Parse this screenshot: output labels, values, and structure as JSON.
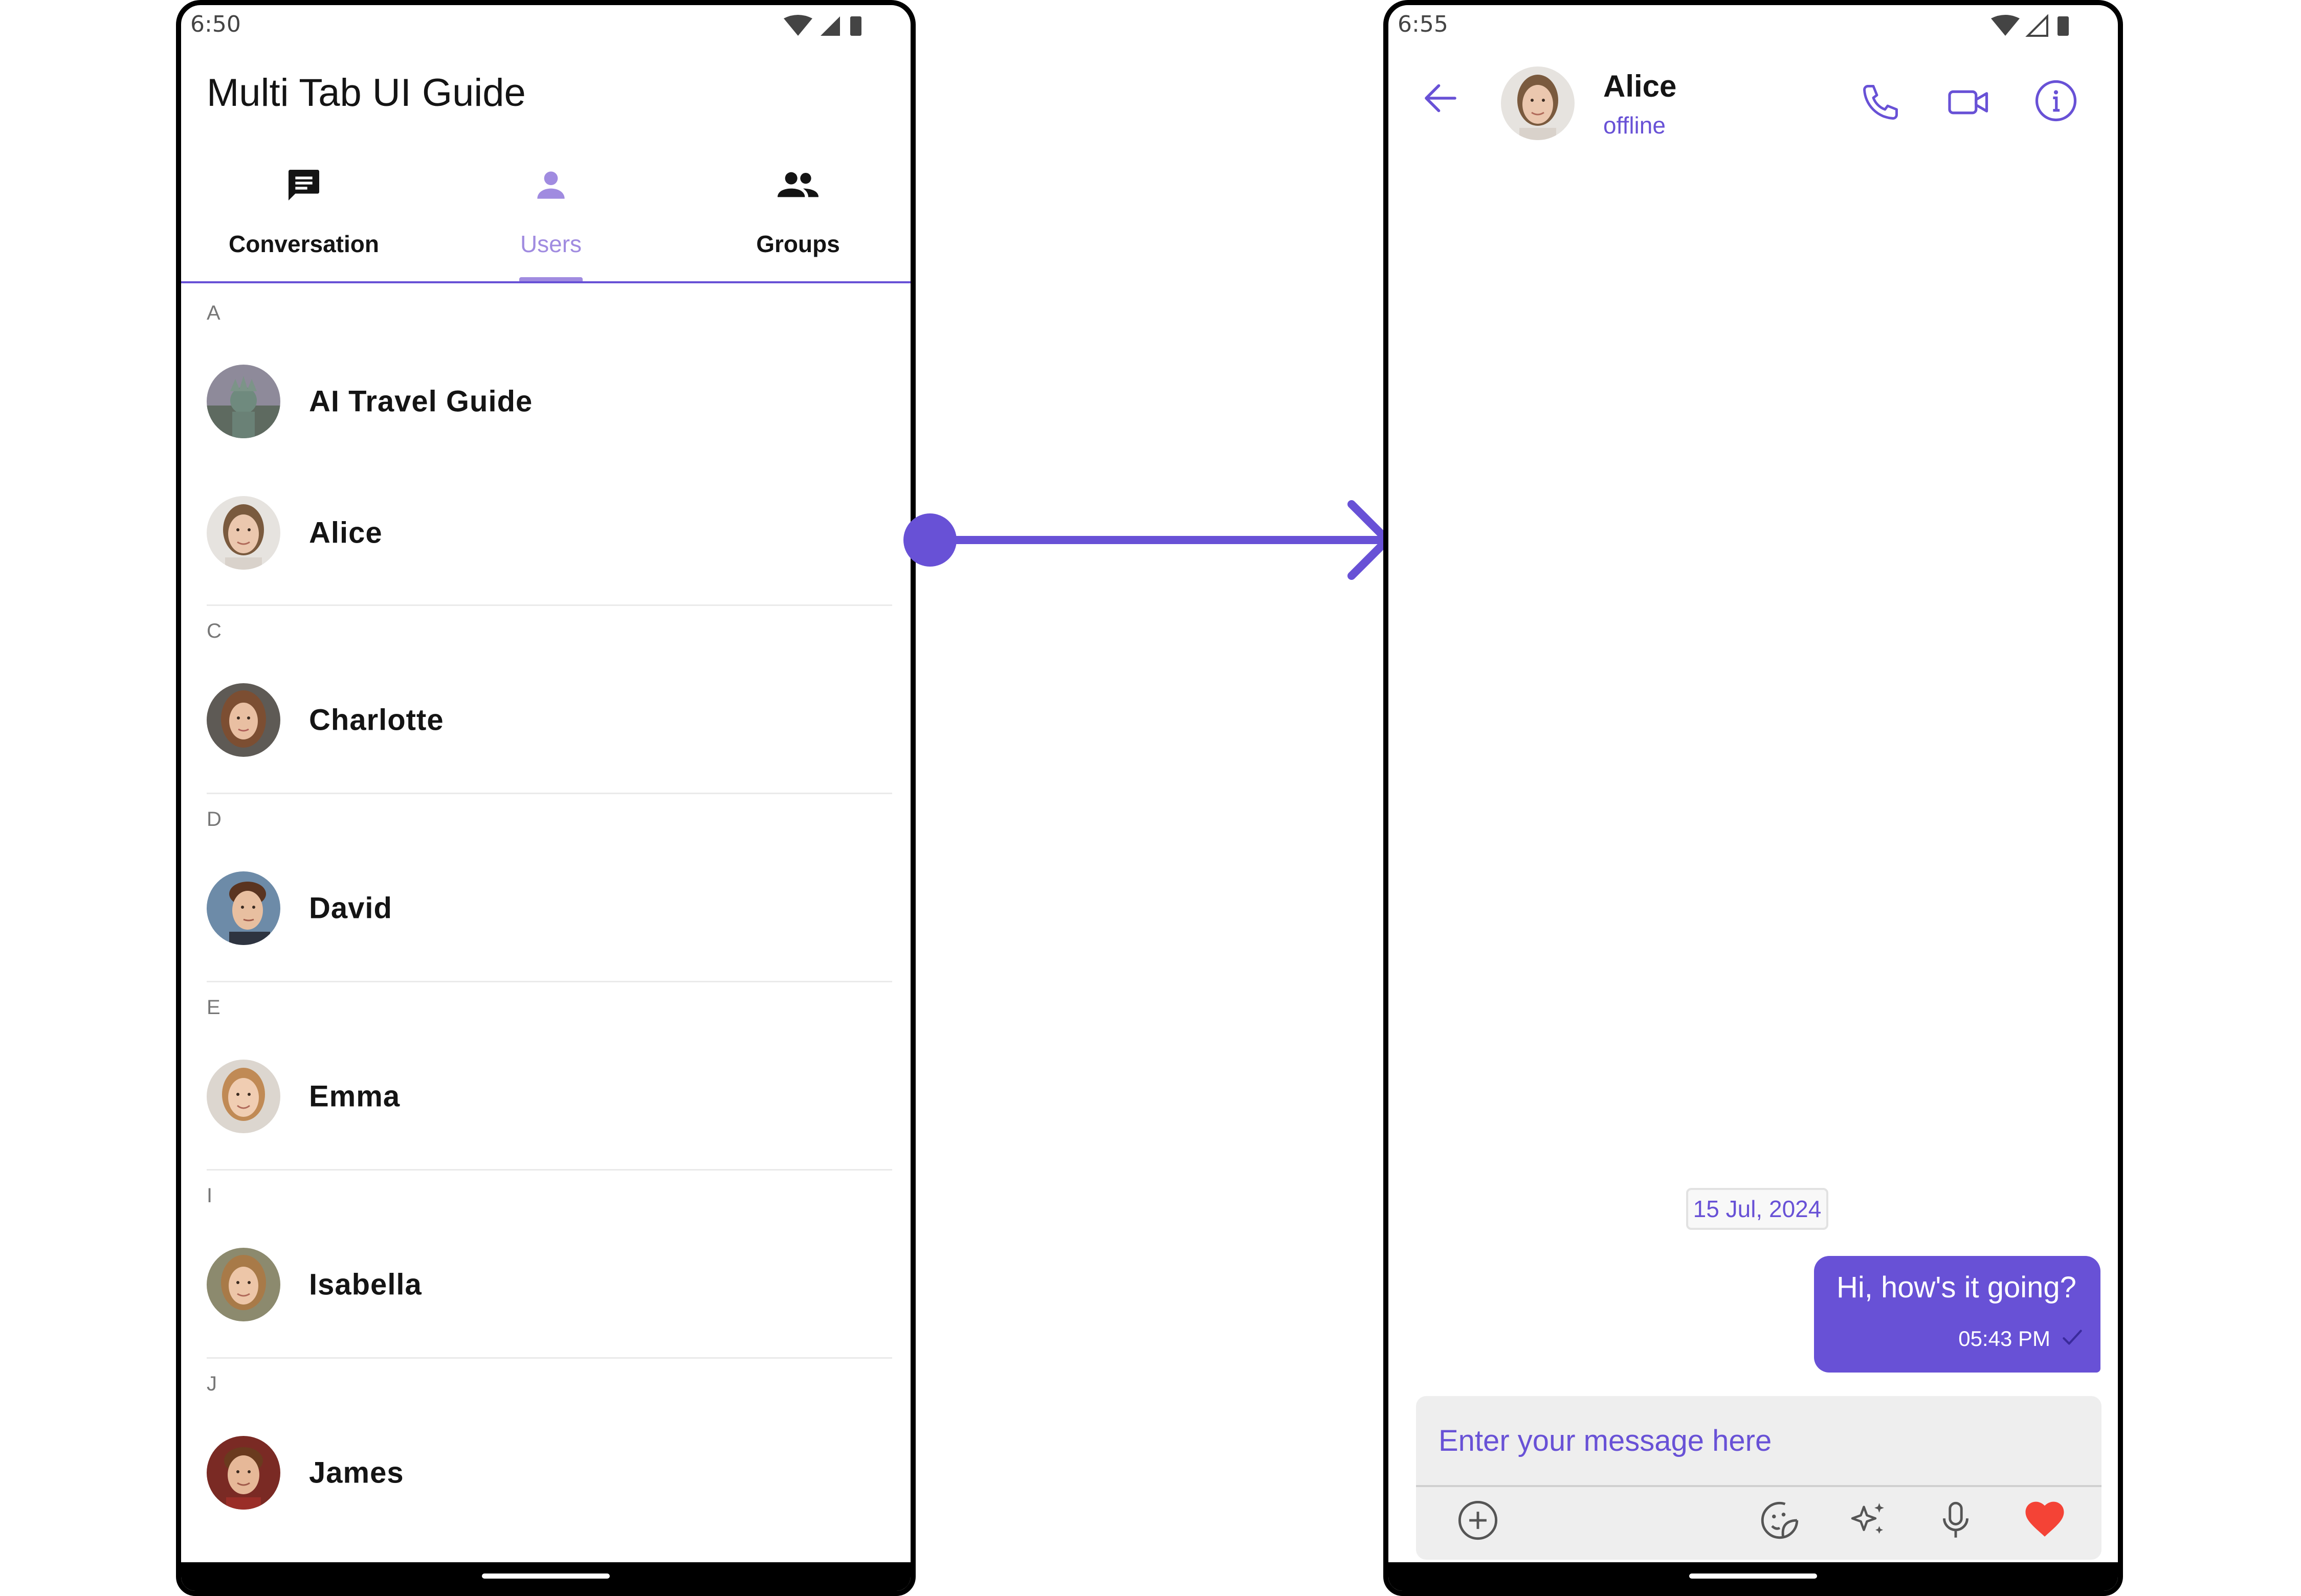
{
  "left_screen": {
    "status_time": "6:50",
    "app_title": "Multi Tab UI Guide",
    "tabs": [
      {
        "label": "Conversation",
        "icon": "chat-icon",
        "active": false
      },
      {
        "label": "Users",
        "icon": "person-icon",
        "active": true
      },
      {
        "label": "Groups",
        "icon": "group-icon",
        "active": false
      }
    ],
    "sections": [
      {
        "letter": "A",
        "users": [
          "AI Travel Guide",
          "Alice"
        ]
      },
      {
        "letter": "C",
        "users": [
          "Charlotte"
        ]
      },
      {
        "letter": "D",
        "users": [
          "David"
        ]
      },
      {
        "letter": "E",
        "users": [
          "Emma"
        ]
      },
      {
        "letter": "I",
        "users": [
          "Isabella"
        ]
      },
      {
        "letter": "J",
        "users": [
          "James"
        ]
      }
    ]
  },
  "right_screen": {
    "status_time": "6:55",
    "header": {
      "name": "Alice",
      "status": "offline"
    },
    "date_separator": "15 Jul, 2024",
    "message": {
      "text": "Hi, how's it going?",
      "time": "05:43 PM"
    },
    "composer_placeholder": "Enter your message here"
  },
  "colors": {
    "accent": "#6851D6",
    "tab_active": "#A08BE0",
    "heart": "#F44336",
    "bubble_text": "#FFFFFF"
  }
}
